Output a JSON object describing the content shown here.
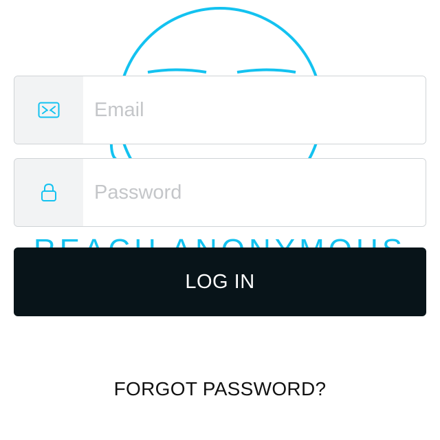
{
  "brand": {
    "name": "REACH ANONYMOUS",
    "accent_color": "#13c2f0"
  },
  "login_form": {
    "email_field": {
      "icon": "envelope-icon",
      "placeholder": "Email",
      "value": ""
    },
    "password_field": {
      "icon": "lock-icon",
      "placeholder": "Password",
      "value": ""
    },
    "login_button": {
      "label": "LOG IN",
      "background_color": "#081419"
    },
    "forgot_password_link": {
      "label": "FORGOT PASSWORD?"
    }
  }
}
